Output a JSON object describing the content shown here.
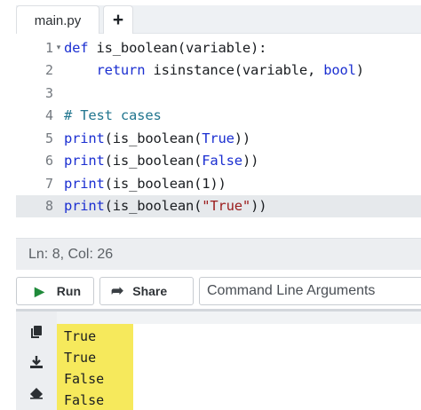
{
  "tabs": [
    {
      "label": "main.py"
    },
    {
      "label": "+"
    }
  ],
  "editor": {
    "line_numbers": [
      "1",
      "2",
      "3",
      "4",
      "5",
      "6",
      "7",
      "8"
    ],
    "lines": [
      [
        {
          "t": "def",
          "c": "kw"
        },
        {
          "t": " is_boolean(variable):",
          "c": ""
        }
      ],
      [
        {
          "t": "    ",
          "c": ""
        },
        {
          "t": "return",
          "c": "kw"
        },
        {
          "t": " isinstance(variable, ",
          "c": ""
        },
        {
          "t": "bool",
          "c": "kw"
        },
        {
          "t": ")",
          "c": ""
        }
      ],
      [],
      [
        {
          "t": "# Test cases",
          "c": "cm"
        }
      ],
      [
        {
          "t": "print",
          "c": "kw"
        },
        {
          "t": "(is_boolean(",
          "c": ""
        },
        {
          "t": "True",
          "c": "bool"
        },
        {
          "t": "))",
          "c": ""
        }
      ],
      [
        {
          "t": "print",
          "c": "kw"
        },
        {
          "t": "(is_boolean(",
          "c": ""
        },
        {
          "t": "False",
          "c": "bool"
        },
        {
          "t": "))",
          "c": ""
        }
      ],
      [
        {
          "t": "print",
          "c": "kw"
        },
        {
          "t": "(is_boolean(",
          "c": ""
        },
        {
          "t": "1",
          "c": "num"
        },
        {
          "t": "))",
          "c": ""
        }
      ],
      [
        {
          "t": "print",
          "c": "kw"
        },
        {
          "t": "(is_boolean(",
          "c": ""
        },
        {
          "t": "\"True\"",
          "c": "str"
        },
        {
          "t": "))",
          "c": ""
        }
      ]
    ],
    "active_line": 8,
    "fold_marker_line": 1
  },
  "status": {
    "text": "Ln: 8,  Col: 26"
  },
  "actions": {
    "run_label": "Run",
    "share_label": "Share",
    "cli_placeholder": "Command Line Arguments"
  },
  "output": {
    "lines": [
      "True",
      "True",
      "False",
      "False"
    ],
    "tools": [
      "copy-icon",
      "download-icon",
      "eraser-icon"
    ],
    "highlight_color": "#f6e95c"
  },
  "colors": {
    "keyword": "#1b2fd1",
    "comment": "#22768f",
    "string": "#9b1c1c",
    "run_icon": "#1f8a3a"
  }
}
